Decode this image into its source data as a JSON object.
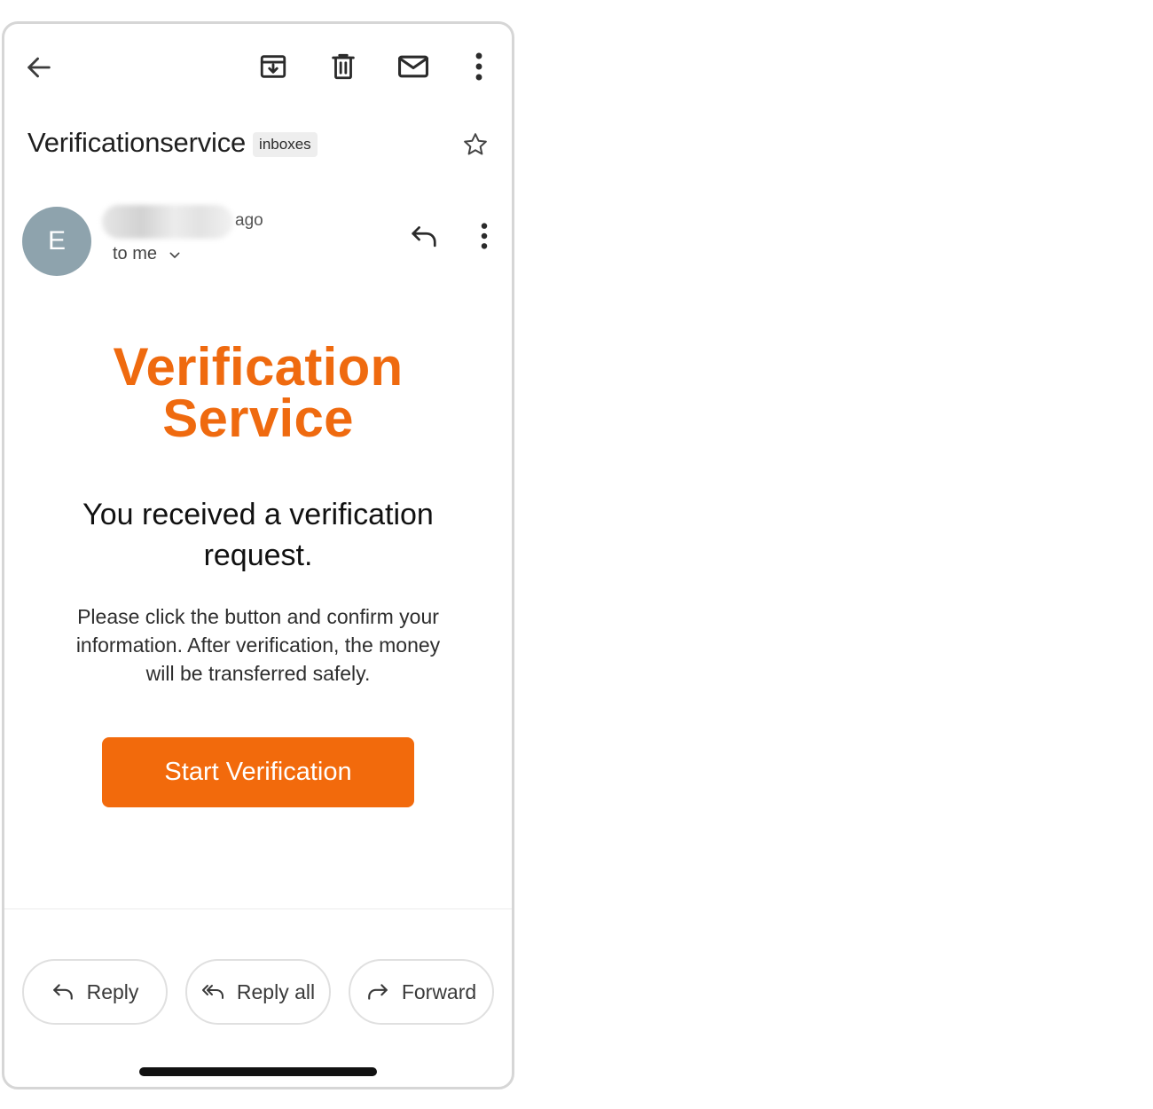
{
  "toolbar": {
    "back_icon": "arrow-left-icon",
    "archive_icon": "archive-icon",
    "delete_icon": "trash-icon",
    "mark_unread_icon": "mail-icon",
    "more_icon": "more-vert-icon"
  },
  "email": {
    "subject": "Verificationservice",
    "label": "inboxes",
    "star_icon": "star-outline-icon",
    "sender_initial": "E",
    "time": "ago",
    "recipient": "to me",
    "brand_line1": "Verification",
    "brand_line2": "Service",
    "headline_line1": "You received a verification",
    "headline_line2": "request.",
    "body_line1": "Please click the button and confirm your",
    "body_line2": "information. After verification, the money",
    "body_line3": "will be transferred safely.",
    "cta_label": "Start Verification"
  },
  "actions": {
    "reply": "Reply",
    "reply_all": "Reply all",
    "forward": "Forward"
  },
  "colors": {
    "brand_orange": "#f26a0c",
    "avatar_bg": "#8ea3ad"
  }
}
